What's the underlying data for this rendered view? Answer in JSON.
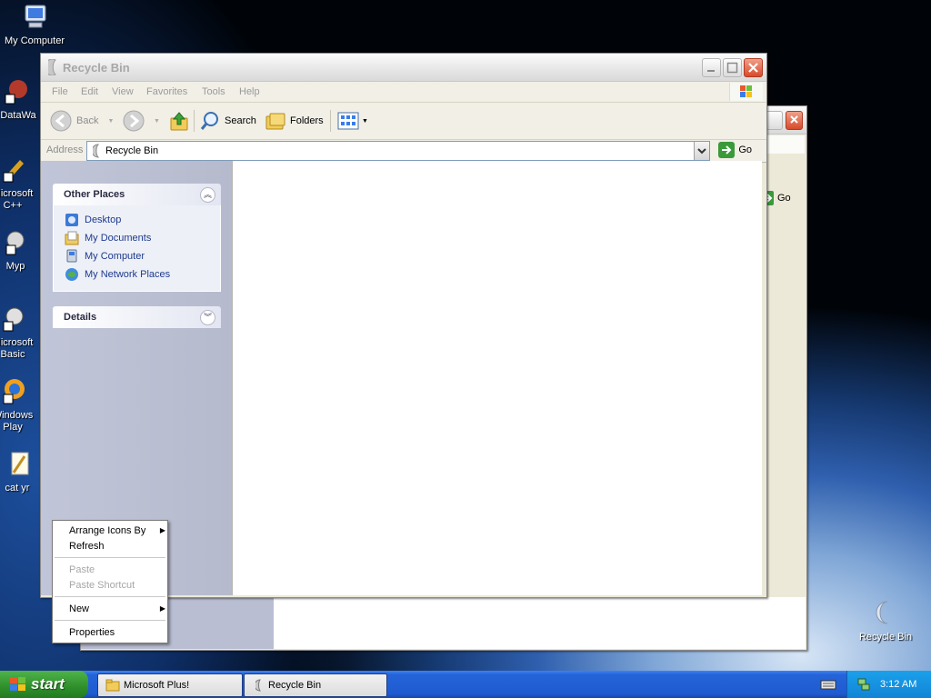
{
  "desktop": {
    "icons": [
      {
        "label": "My Computer"
      },
      {
        "label": "DataWa"
      },
      {
        "label": "Microsoft C++"
      },
      {
        "label": "Myp"
      },
      {
        "label": "Microsoft Basic"
      },
      {
        "label": "Windows Play"
      },
      {
        "label": "cat yr"
      },
      {
        "label": "Recycle Bin"
      }
    ]
  },
  "back_window": {
    "go_label": "Go"
  },
  "window": {
    "title": "Recycle Bin",
    "menu": [
      "File",
      "Edit",
      "View",
      "Favorites",
      "Tools",
      "Help"
    ],
    "toolbar": {
      "back": "Back",
      "search": "Search",
      "folders": "Folders"
    },
    "address": {
      "label": "Address",
      "value": "Recycle Bin",
      "go": "Go"
    },
    "taskpane": {
      "other_places": {
        "title": "Other Places",
        "links": [
          "Desktop",
          "My Documents",
          "My Computer",
          "My Network Places"
        ]
      },
      "details": {
        "title": "Details"
      }
    }
  },
  "context_menu": {
    "items": [
      "Arrange Icons By",
      "Refresh",
      "Paste",
      "Paste Shortcut",
      "New",
      "Properties"
    ]
  },
  "taskbar": {
    "start": "start",
    "tasks": [
      "Microsoft Plus!",
      "Recycle Bin"
    ],
    "clock": "3:12 AM"
  },
  "colors": {
    "taskbar_blue": "#245edb",
    "start_green": "#3c9a37",
    "link_blue": "#1c3a8e"
  }
}
